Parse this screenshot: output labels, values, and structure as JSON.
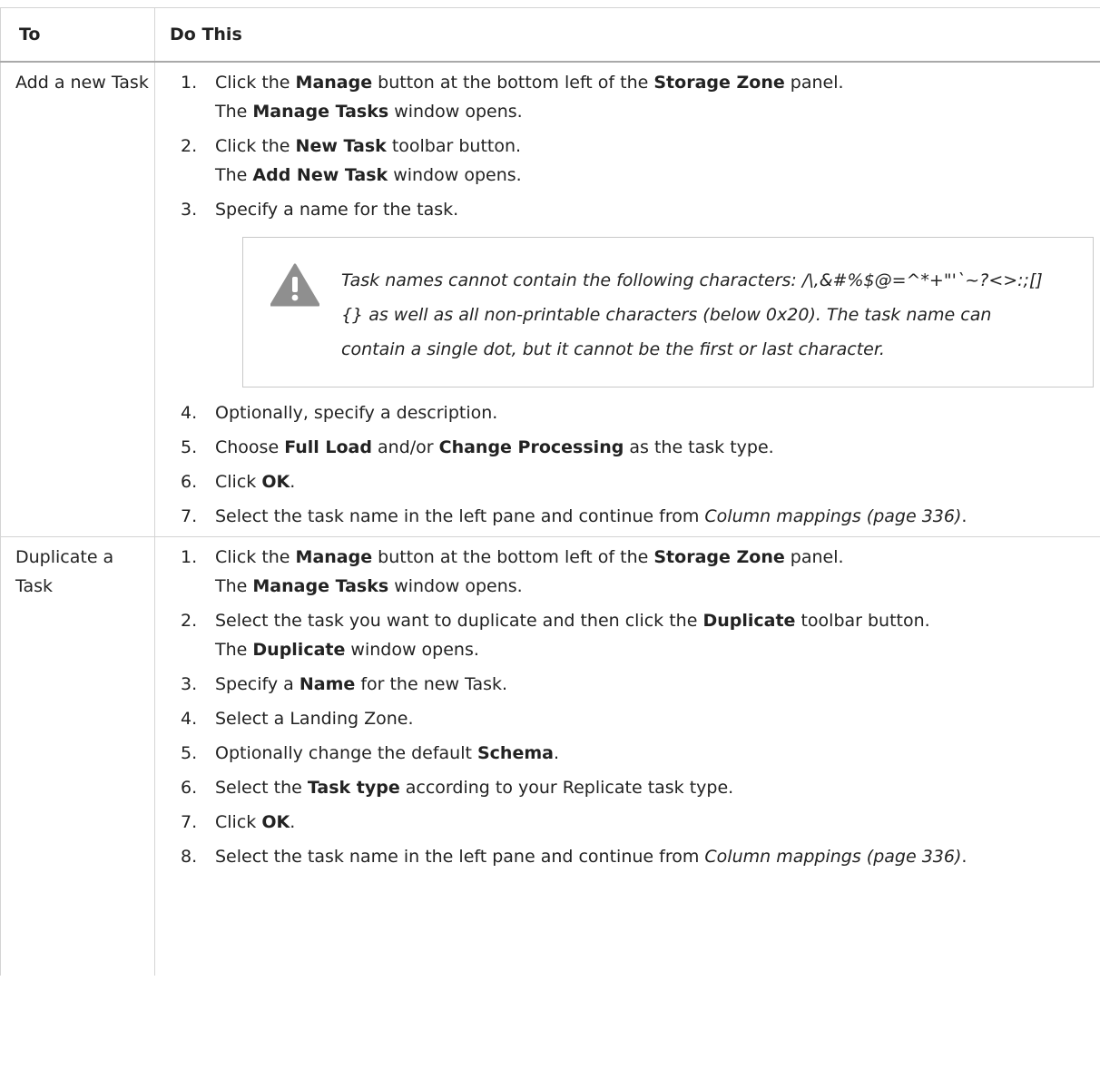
{
  "header": {
    "col1": "To",
    "col2": "Do This"
  },
  "rows": [
    {
      "label": "Add a new Task",
      "steps": [
        {
          "n": "1.",
          "segments": [
            {
              "t": "Click the "
            },
            {
              "b": "Manage"
            },
            {
              "t": " button at the bottom left of the "
            },
            {
              "b": "Storage Zone"
            },
            {
              "t": " panel."
            },
            {
              "br": true
            },
            {
              "t": "The "
            },
            {
              "b": "Manage Tasks"
            },
            {
              "t": " window opens."
            }
          ]
        },
        {
          "n": "2.",
          "segments": [
            {
              "t": "Click the "
            },
            {
              "b": "New Task"
            },
            {
              "t": " toolbar button."
            },
            {
              "br": true
            },
            {
              "t": "The "
            },
            {
              "b": "Add New Task"
            },
            {
              "t": " window opens."
            }
          ]
        },
        {
          "n": "3.",
          "segments": [
            {
              "t": "Specify a name for the task."
            }
          ]
        },
        {
          "note": "Task names cannot contain the following characters: /\\,&#%$@=^*+\"'`~?<>:;[]{} as well as all non-printable characters (below 0x20). The task name can contain a single dot, but it cannot be the first or last character."
        },
        {
          "n": "4.",
          "segments": [
            {
              "t": "Optionally, specify a description."
            }
          ]
        },
        {
          "n": "5.",
          "segments": [
            {
              "t": "Choose "
            },
            {
              "b": "Full Load"
            },
            {
              "t": " and/or "
            },
            {
              "b": "Change Processing"
            },
            {
              "t": " as the task type."
            }
          ]
        },
        {
          "n": "6.",
          "segments": [
            {
              "t": "Click "
            },
            {
              "b": "OK"
            },
            {
              "t": "."
            }
          ]
        },
        {
          "n": "7.",
          "segments": [
            {
              "t": "Select the task name in the left pane and continue from "
            },
            {
              "i": "Column mappings (page 336)"
            },
            {
              "t": "."
            }
          ]
        }
      ]
    },
    {
      "label": "Duplicate a Task",
      "steps": [
        {
          "n": "1.",
          "segments": [
            {
              "t": "Click the "
            },
            {
              "b": "Manage"
            },
            {
              "t": " button at the bottom left of the "
            },
            {
              "b": "Storage Zone"
            },
            {
              "t": " panel."
            },
            {
              "br": true
            },
            {
              "t": "The "
            },
            {
              "b": "Manage Tasks"
            },
            {
              "t": " window opens."
            }
          ]
        },
        {
          "n": "2.",
          "segments": [
            {
              "t": "Select the task you want to duplicate and then click the "
            },
            {
              "b": "Duplicate"
            },
            {
              "t": " toolbar button."
            },
            {
              "br": true
            },
            {
              "t": "The "
            },
            {
              "b": "Duplicate"
            },
            {
              "t": " window opens."
            }
          ]
        },
        {
          "n": "3.",
          "segments": [
            {
              "t": "Specify a "
            },
            {
              "b": "Name"
            },
            {
              "t": " for the new Task."
            }
          ]
        },
        {
          "n": "4.",
          "segments": [
            {
              "t": "Select a Landing Zone."
            }
          ]
        },
        {
          "n": "5.",
          "segments": [
            {
              "t": "Optionally change the default "
            },
            {
              "b": "Schema"
            },
            {
              "t": "."
            }
          ]
        },
        {
          "n": "6.",
          "segments": [
            {
              "t": "Select the "
            },
            {
              "b": "Task type"
            },
            {
              "t": " according to your Replicate task type."
            }
          ]
        },
        {
          "n": "7.",
          "segments": [
            {
              "t": "Click "
            },
            {
              "b": "OK"
            },
            {
              "t": "."
            }
          ]
        },
        {
          "n": "8.",
          "segments": [
            {
              "t": "Select the task name in the left pane and continue from "
            },
            {
              "i": "Column mappings (page 336)"
            },
            {
              "t": "."
            }
          ]
        }
      ]
    }
  ]
}
